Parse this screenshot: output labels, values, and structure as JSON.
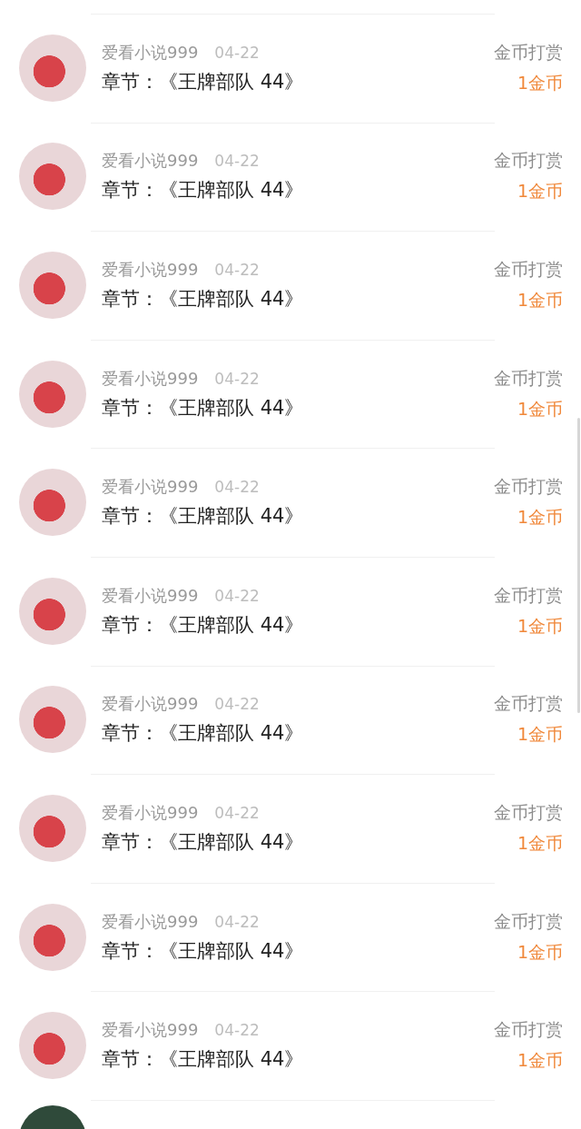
{
  "rewards": [
    {
      "user": "爱看小说999",
      "date": "04-22",
      "chapter": "章节：《王牌部队 44》",
      "type": "金币打赏",
      "amount": "1金币"
    },
    {
      "user": "爱看小说999",
      "date": "04-22",
      "chapter": "章节：《王牌部队 44》",
      "type": "金币打赏",
      "amount": "1金币"
    },
    {
      "user": "爱看小说999",
      "date": "04-22",
      "chapter": "章节：《王牌部队 44》",
      "type": "金币打赏",
      "amount": "1金币"
    },
    {
      "user": "爱看小说999",
      "date": "04-22",
      "chapter": "章节：《王牌部队 44》",
      "type": "金币打赏",
      "amount": "1金币"
    },
    {
      "user": "爱看小说999",
      "date": "04-22",
      "chapter": "章节：《王牌部队 44》",
      "type": "金币打赏",
      "amount": "1金币"
    },
    {
      "user": "爱看小说999",
      "date": "04-22",
      "chapter": "章节：《王牌部队 44》",
      "type": "金币打赏",
      "amount": "1金币"
    },
    {
      "user": "爱看小说999",
      "date": "04-22",
      "chapter": "章节：《王牌部队 44》",
      "type": "金币打赏",
      "amount": "1金币"
    },
    {
      "user": "爱看小说999",
      "date": "04-22",
      "chapter": "章节：《王牌部队 44》",
      "type": "金币打赏",
      "amount": "1金币"
    },
    {
      "user": "爱看小说999",
      "date": "04-22",
      "chapter": "章节：《王牌部队 44》",
      "type": "金币打赏",
      "amount": "1金币"
    },
    {
      "user": "爱看小说999",
      "date": "04-22",
      "chapter": "章节：《王牌部队 44》",
      "type": "金币打赏",
      "amount": "1金币"
    }
  ]
}
